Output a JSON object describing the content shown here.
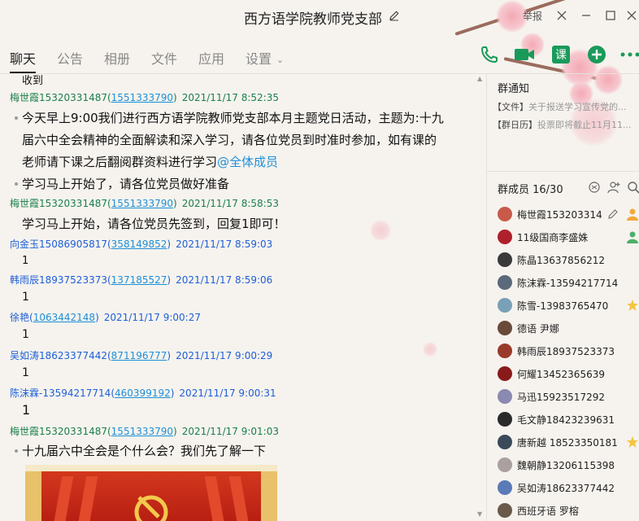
{
  "window": {
    "title": "西方语学院教师党支部",
    "report": "举报"
  },
  "tabs": [
    {
      "label": "聊天"
    },
    {
      "label": "公告"
    },
    {
      "label": "相册"
    },
    {
      "label": "文件"
    },
    {
      "label": "应用"
    },
    {
      "label": "设置"
    }
  ],
  "toolbar": {
    "course_label": "课"
  },
  "chat": {
    "partial_top": "收到",
    "messages": [
      {
        "name": "梅世霞15320331487",
        "qq": "1551333790",
        "time": "2021/11/17 8:52:35",
        "lines": [
          "今天早上9:00我们进行西方语学院教师党支部本月主题党日活动，主题为:十九",
          "届六中全会精神的全面解读和深入学习，请各位党员到时准时参加，如有课的",
          "老师请下课之后翻阅群资料进行学习"
        ],
        "mention": "@全体成员",
        "extra": "学习马上开始了，请各位党员做好准备"
      },
      {
        "name": "梅世霞15320331487",
        "qq": "1551333790",
        "time": "2021/11/17 8:58:53",
        "text": "学习马上开始，请各位党员先签到，回复1即可！"
      },
      {
        "name": "向金玉15086905817",
        "qq": "358149852",
        "time": "2021/11/17 8:59:03",
        "text": "1"
      },
      {
        "name": "韩雨辰18937523373",
        "qq": "137185527",
        "time": "2021/11/17 8:59:06",
        "text": "1"
      },
      {
        "name": "徐艳",
        "qq": "1063442148",
        "time": "2021/11/17 9:00:27",
        "text": "1"
      },
      {
        "name": "吴如涛18623377442",
        "qq": "871196777",
        "time": "2021/11/17 9:00:29",
        "text": "1"
      },
      {
        "name": "陈沫霖-13594217714",
        "qq": "460399192",
        "time": "2021/11/17 9:00:31",
        "text": "1"
      },
      {
        "name": "梅世霞15320331487",
        "qq": "1551333790",
        "time": "2021/11/17 9:01:03",
        "text": "十九届六中全会是个什么会？我们先了解一下"
      }
    ]
  },
  "notices": {
    "title": "群通知",
    "items": [
      {
        "tag": "【文件】",
        "text": "关于报送学习宣传党的..."
      },
      {
        "tag": "【群日历】",
        "text": "投票即将截止11月11..."
      }
    ]
  },
  "members": {
    "header": "群成员 16/30",
    "list": [
      {
        "name": "梅世霞153203314",
        "color": "#c85a4a"
      },
      {
        "name": "11级国商李盛姝",
        "color": "#b0202a"
      },
      {
        "name": "陈晶13637856212",
        "color": "#3a3a3a"
      },
      {
        "name": "陈沫霖-13594217714",
        "color": "#5a6a7a"
      },
      {
        "name": "陈雪-13983765470",
        "color": "#7aa0b8"
      },
      {
        "name": "德语 尹娜",
        "color": "#6a4a3a"
      },
      {
        "name": "韩雨辰18937523373",
        "color": "#9a3a2a"
      },
      {
        "name": "何耀13452365639",
        "color": "#8a1a1a"
      },
      {
        "name": "马迅15923517292",
        "color": "#8a8ab0"
      },
      {
        "name": "毛文静18423239631",
        "color": "#2a2a2a"
      },
      {
        "name": "唐新越 18523350181",
        "color": "#3a4a5a"
      },
      {
        "name": "魏朝静13206115398",
        "color": "#aaa0a0"
      },
      {
        "name": "吴如涛18623377442",
        "color": "#5a7ab8"
      },
      {
        "name": "西班牙语 罗榕",
        "color": "#6a5a4a"
      }
    ]
  }
}
